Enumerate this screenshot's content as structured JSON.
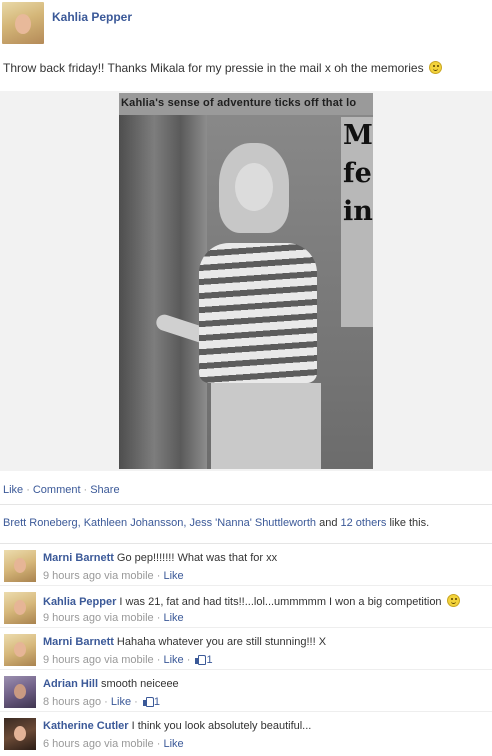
{
  "post": {
    "author": "Kahlia Pepper",
    "text": "Throw back friday!! Thanks Mikala for my pressie in the mail x oh the memories",
    "photo": {
      "headline": "Kahlia's sense of adventure ticks off that lo",
      "big_letters": [
        "M",
        "fe",
        "in"
      ]
    }
  },
  "actions": {
    "like": "Like",
    "comment": "Comment",
    "share": "Share",
    "separator": "·"
  },
  "likes": {
    "names": "Brett Roneberg, Kathleen Johansson, Jess 'Nanna' Shuttleworth",
    "connector": "and",
    "others": "12 others",
    "suffix": "like this."
  },
  "comments": [
    {
      "name": "Marni Barnett",
      "text": "Go pep!!!!!!! What was that for xx",
      "time": "9 hours ago via mobile",
      "like": "Like",
      "likes": ""
    },
    {
      "name": "Kahlia Pepper",
      "text": "I was 21, fat and had tits!!...lol...ummmmm I won a big competition",
      "time": "9 hours ago via mobile",
      "like": "Like",
      "likes": ""
    },
    {
      "name": "Marni Barnett",
      "text": "Hahaha whatever you are still stunning!!! X",
      "time": "9 hours ago via mobile",
      "like": "Like",
      "likes": "1"
    },
    {
      "name": "Adrian Hill",
      "text": "smooth neiceee",
      "time": "8 hours ago",
      "like": "Like",
      "likes": "1"
    },
    {
      "name": "Katherine Cutler",
      "text": "I think you look absolutely beautiful...",
      "time": "6 hours ago via mobile",
      "like": "Like",
      "likes": ""
    }
  ],
  "icons": {
    "smiley": "smiley-emoticon-icon",
    "thumb": "thumbs-up-icon"
  },
  "colors": {
    "link": "#3b5998",
    "meta": "#999999"
  }
}
